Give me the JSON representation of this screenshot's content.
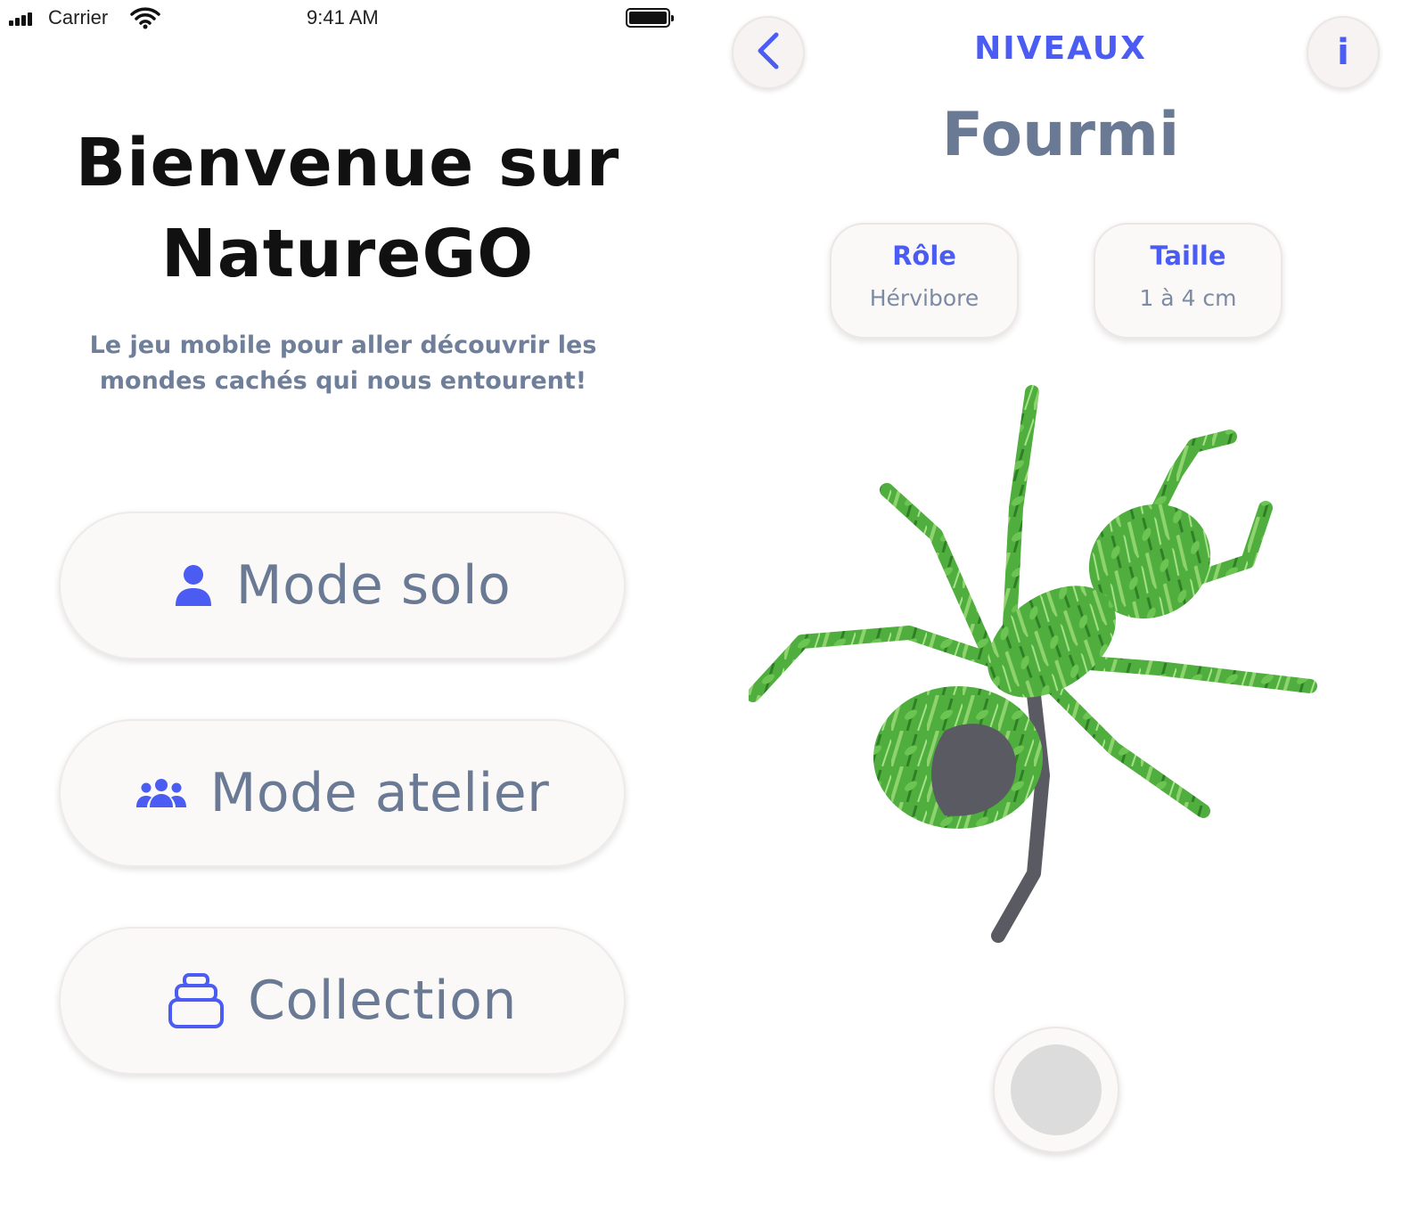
{
  "status_bar": {
    "carrier": "Carrier",
    "time": "9:41 AM",
    "icons": [
      "signal-bars-icon",
      "wifi-icon",
      "battery-icon"
    ]
  },
  "home": {
    "title_line1": "Bienvenue sur",
    "title_line2": "NatureGO",
    "tagline_line1": "Le jeu mobile pour aller découvrir les",
    "tagline_line2": "mondes cachés qui nous entourent!",
    "buttons": [
      {
        "label": "Mode solo",
        "icon": "person-icon"
      },
      {
        "label": "Mode atelier",
        "icon": "group-icon"
      },
      {
        "label": "Collection",
        "icon": "stack-icon"
      }
    ]
  },
  "detail": {
    "header": "NIVEAUX",
    "back_icon": "chevron-left-icon",
    "info_label": "i",
    "species_name": "Fourmi",
    "cards": [
      {
        "title": "Rôle",
        "value": "Hérvibore"
      },
      {
        "title": "Taille",
        "value": "1 à 4 cm"
      }
    ],
    "image": "ant-silhouette-grass-texture"
  },
  "colors": {
    "accent": "#4a5cf2",
    "text_muted": "#6a7a94",
    "button_bg": "#fbf9f8",
    "title": "#111111"
  }
}
